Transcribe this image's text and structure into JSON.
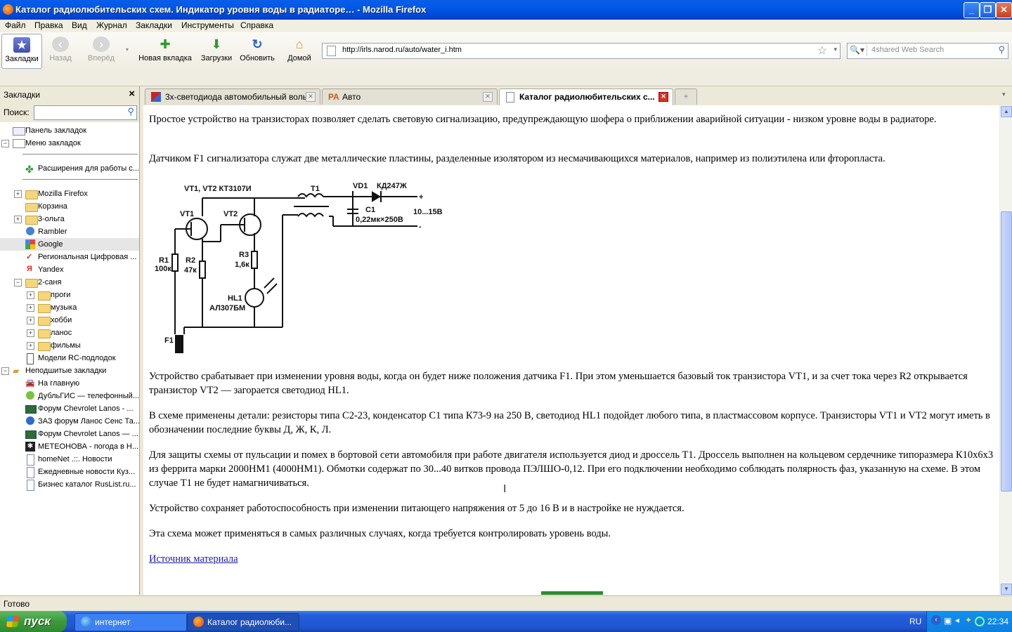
{
  "window": {
    "title": "Каталог радиолюбительских схем. Индикатор уровня воды в радиаторе… - Mozilla Firefox"
  },
  "menu": [
    "Файл",
    "Правка",
    "Вид",
    "Журнал",
    "Закладки",
    "Инструменты",
    "Справка"
  ],
  "toolbar": {
    "bookmarks": "Закладки",
    "back": "Назад",
    "forward": "Вперёд",
    "new_tab": "Новая вкладка",
    "downloads": "Загрузки",
    "reload": "Обновить",
    "home": "Домой",
    "url": "http://irls.narod.ru/auto/water_i.htm",
    "search_placeholder": "4shared Web Search"
  },
  "sidebar": {
    "title": "Закладки",
    "search_label": "Поиск:",
    "items": [
      {
        "label": "Панель закладок"
      },
      {
        "label": "Меню закладок"
      },
      {
        "label": "Расширения для работы с..."
      },
      {
        "label": "Mozilla Firefox"
      },
      {
        "label": "Корзина"
      },
      {
        "label": "3-ольга"
      },
      {
        "label": "Rambler"
      },
      {
        "label": "Google"
      },
      {
        "label": "Региональная Цифровая ..."
      },
      {
        "label": "Yandex"
      },
      {
        "label": "2-саня"
      },
      {
        "label": "проги"
      },
      {
        "label": "музыка"
      },
      {
        "label": "хобби"
      },
      {
        "label": "ланос"
      },
      {
        "label": "фильмы"
      },
      {
        "label": "Модели RC-подлодок"
      },
      {
        "label": "Неподшитые закладки"
      },
      {
        "label": "На главную"
      },
      {
        "label": "ДубльГИС — телефонный..."
      },
      {
        "label": "Форум Chevrolet Lanos - ..."
      },
      {
        "label": "ЗАЗ форум Ланос Сенс Та..."
      },
      {
        "label": "Форум Chevrolet Lanos — ..."
      },
      {
        "label": "МЕТЕОНОВА - погода в Н..."
      },
      {
        "label": "homeNet .::. Новости"
      },
      {
        "label": "Ежедневные новости Куз..."
      },
      {
        "label": "Бизнес каталог RusList.ru..."
      }
    ]
  },
  "tabs": [
    {
      "label": "3х-светодиода автомобильный воль..."
    },
    {
      "label": "Авто"
    },
    {
      "label": "Каталог радиолюбительских с..."
    }
  ],
  "content": {
    "p1": "Простое устройство на транзисторах позволяет сделать световую сигнализацию, предупреждающую шофера о приближении аварийной ситуации - низком уровне воды в радиаторе.",
    "p2": "Датчиком F1 сигнализатора служат две металлические пластины, разделенные изолятором из несмачивающихся материалов, например из полиэтилена или фторопласта.",
    "p3": "Устройство срабатывает при изменении уровня воды, когда он будет ниже положения датчика F1. При этом уменьшается базовый ток транзистора VT1, и за счет тока через R2 открывается транзистор VT2 — загорается светодиод HL1.",
    "p4": "В схеме применены детали: резисторы типа С2-23, конденсатор С1 типа К73-9 на 250 В, светодиод HL1 подойдет любого типа, в пластмассовом корпусе. Транзисторы VT1 и VT2 могут иметь в обозначении последние буквы Д, Ж, К, Л.",
    "p5": "Для защиты схемы от пульсации и помех в бортовой сети автомобиля при работе двигателя используется диод и дроссель Т1. Дроссель выполнен на кольцевом сердечнике типоразмера К10х6х3 из феррита марки 2000НМ1 (4000НМ1). Обмотки содержат по 30...40 витков провода ПЭЛШО-0,12. При его подключении необходимо соблюдать полярность фаз, указанную на схеме. В этом случае Т1 не будет намагничиваться.",
    "p6": "Устройство сохраняет работоспособность при изменении питающего напряжения от 5 до 16 В и в настройке не нуждается.",
    "p7": "Эта схема может применяться в самых различных случаях, когда требуется контролировать уровень воды.",
    "source_link": "Источник материала"
  },
  "schematic": {
    "vt_title": "VT1, VT2  КТ3107И",
    "t1": "T1",
    "vd1": "VD1",
    "vd_type": "КД247Ж",
    "plus": "+",
    "minus": "-",
    "vt1": "VT1",
    "vt2": "VT2",
    "c1": "C1",
    "c1_val": "0,22мк×250В",
    "range": "10...15В",
    "r1": "R1",
    "r1_val": "100к",
    "r2": "R2",
    "r2_val": "47к",
    "r3": "R3",
    "r3_val": "1,6к",
    "hl1": "HL1",
    "hl1_type": "АЛ307БМ",
    "f1": "F1"
  },
  "status": "Готово",
  "taskbar": {
    "start": "пуск",
    "tasks": [
      "интернет",
      "Каталог радиолюби..."
    ],
    "lang": "RU",
    "time": "22:34"
  }
}
